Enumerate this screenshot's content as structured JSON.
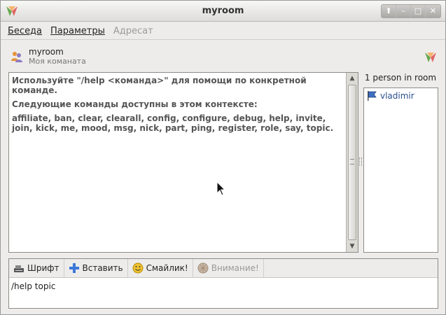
{
  "window": {
    "title": "myroom"
  },
  "menu": [
    {
      "label": "Беседа",
      "enabled": true
    },
    {
      "label": "Параметры",
      "enabled": true
    },
    {
      "label": "Адресат",
      "enabled": false
    }
  ],
  "room": {
    "name": "myroom",
    "subject": "Моя команата"
  },
  "chat": {
    "lines": [
      "Используйте \"/help <команда>\" для помощи по конкретной команде.",
      "Следующие команды доступны в этом контексте:",
      "affiliate, ban, clear, clearall, config, configure, debug, help, invite, join, kick, me, mood, msg, nick, part, ping, register, role, say, topic."
    ]
  },
  "roster": {
    "count_label": "1 person in room",
    "people": [
      {
        "name": "vladimir"
      }
    ]
  },
  "toolbar": {
    "font_label": "Шрифт",
    "insert_label": "Вставить",
    "smiley_label": "Смайлик!",
    "attention_label": "Внимание!"
  },
  "composer": {
    "value": "/help topic"
  },
  "colors": {
    "accent_link": "#2a4f8f",
    "disabled": "#9b9a97"
  },
  "icons": [
    "app-logo-icon",
    "room-icon",
    "flag-icon",
    "font-icon",
    "plus-icon",
    "smiley-icon",
    "attention-icon"
  ]
}
